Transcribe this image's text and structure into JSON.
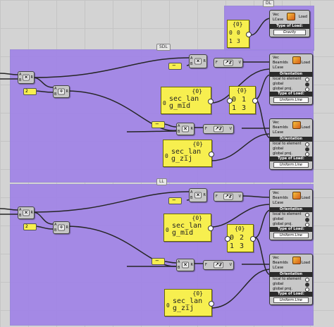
{
  "groups": {
    "top": {
      "tag": "DL"
    },
    "middle": {
      "tag": "SDL"
    },
    "bottom": {
      "tag": "LL"
    }
  },
  "colors": {
    "group": "#a082e6",
    "panel": "#f7ef4f",
    "component": "#c6c6c6"
  },
  "loads": {
    "gravity": {
      "inputs": [
        "Vec",
        "LCase"
      ],
      "output": "Load",
      "section": "Type of Load:",
      "value": "Gravity"
    },
    "beam": {
      "inputs": [
        "Vec",
        "BeamIds",
        "LCase"
      ],
      "output": "Load",
      "orientation": "Orientation",
      "options": [
        "local to element",
        "global",
        "global proj."
      ],
      "section": "Type of Load:",
      "value": "Uniform Line"
    }
  },
  "ops": {
    "mult": {
      "a": "A",
      "b": "B",
      "r": "R",
      "symbol": "×"
    },
    "div": {
      "a": "A",
      "b": "B",
      "r": "R",
      "symbol": "÷"
    },
    "vec": {
      "f": "F",
      "v": "V"
    }
  },
  "sliders": {
    "neg": "−",
    "two": "2"
  },
  "panels": {
    "dl_case": {
      "index": "{0}",
      "rows": [
        "0",
        "1"
      ],
      "vals": [
        "0",
        "3"
      ]
    },
    "sdl_mid": {
      "index": "{0}",
      "row": "0",
      "text": "sec_lan g_mid"
    },
    "sdl_zij": {
      "index": "{0}",
      "row": "0",
      "text": "sec_lan g_zij"
    },
    "sdl_case": {
      "index": "{0}",
      "rows": [
        "0",
        "1"
      ],
      "vals": [
        "1",
        "3"
      ]
    },
    "ll_mid": {
      "index": "{0}",
      "row": "0",
      "text": "sec_lan g_mid"
    },
    "ll_zij": {
      "index": "{0}",
      "row": "0",
      "text": "sec_lan g_zij"
    },
    "ll_case": {
      "index": "{0}",
      "rows": [
        "0",
        "1"
      ],
      "vals": [
        "2",
        "3"
      ]
    }
  }
}
